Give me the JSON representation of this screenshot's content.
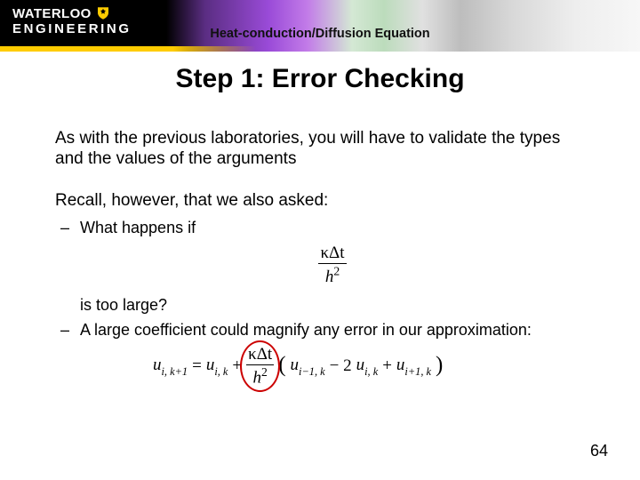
{
  "banner": {
    "logo_line1": "WATERLOO",
    "logo_line2": "ENGINEERING",
    "header_label": "Heat-conduction/Diffusion Equation"
  },
  "title": "Step 1:  Error Checking",
  "body": {
    "p1": "As with the previous laboratories, you will have to validate the types and the values of the arguments",
    "p2": "Recall, however, that we also asked:",
    "b1": "What happens if",
    "frac1_num": "κΔt",
    "frac1_den_h": "h",
    "frac1_den_exp": "2",
    "b1_tail": "is too large?",
    "b2": "A large coefficient could magnify any error in our approximation:",
    "eq": {
      "lhs_u": "u",
      "lhs_sub": "i, k+1",
      "eq_sign": " = ",
      "rhs1_u": "u",
      "rhs1_sub": "i, k",
      "plus": " + ",
      "frac_num": "κΔt",
      "frac_den_h": "h",
      "frac_den_exp": "2",
      "lparen": "(",
      "t1_u": "u",
      "t1_sub": "i−1, k",
      "minus2": " − 2",
      "t2_u": "u",
      "t2_sub": "i, k",
      "plus2": " + ",
      "t3_u": "u",
      "t3_sub": "i+1, k",
      "rparen": ")"
    }
  },
  "page_number": "64"
}
